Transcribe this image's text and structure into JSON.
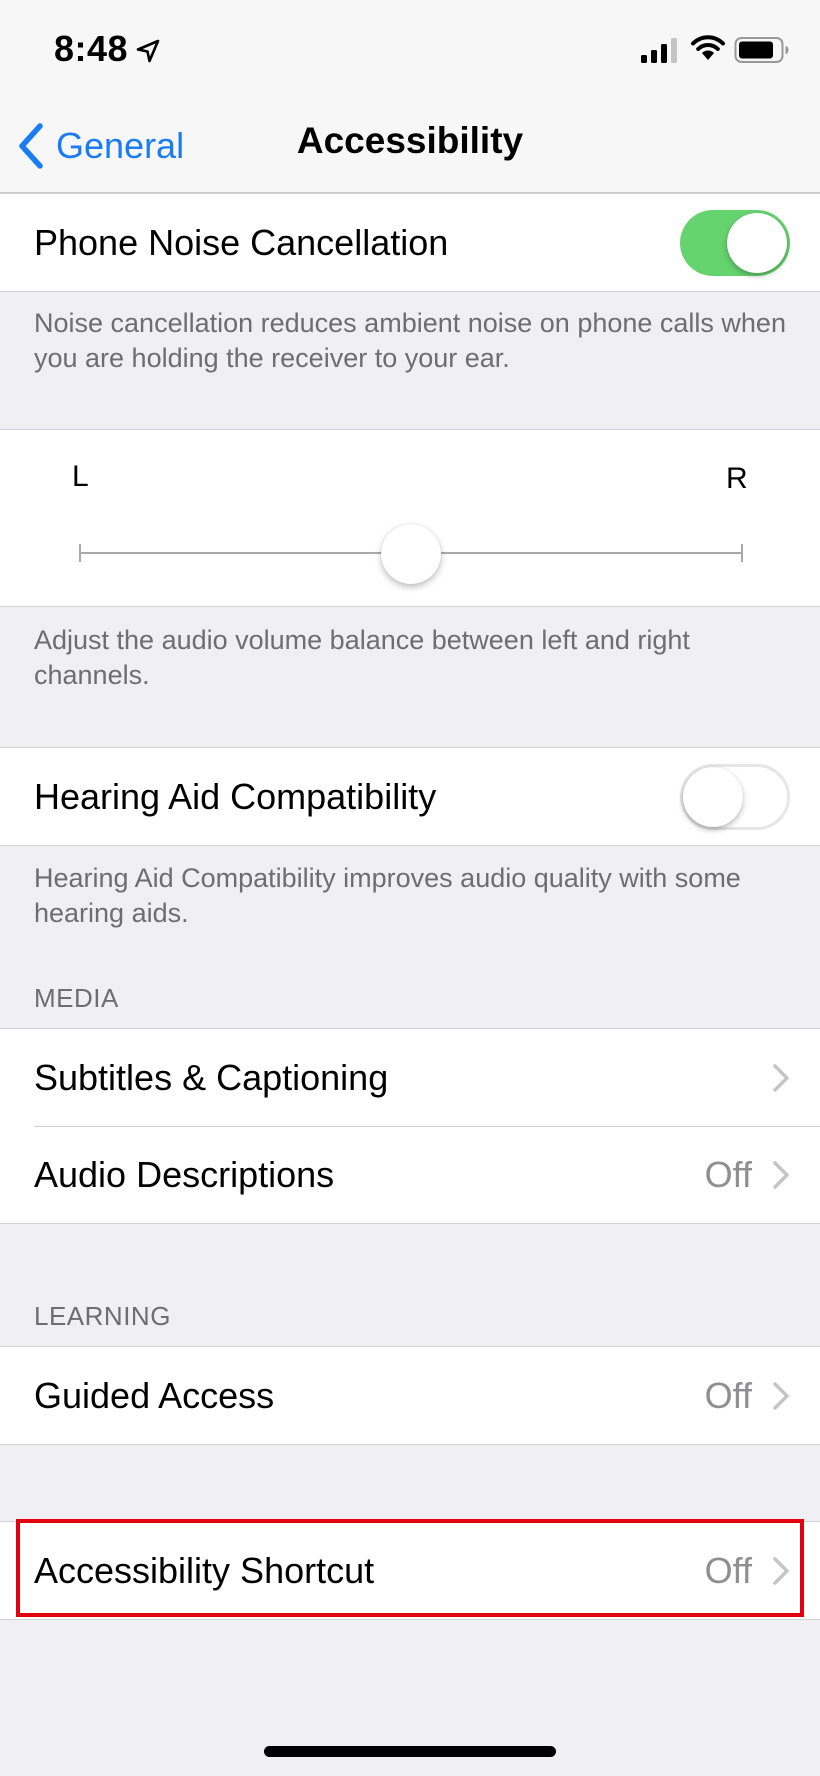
{
  "status_bar": {
    "time": "8:48"
  },
  "nav": {
    "back_label": "General",
    "title": "Accessibility"
  },
  "noise_cancellation": {
    "label": "Phone Noise Cancellation",
    "enabled": true,
    "footnote": "Noise cancellation reduces ambient noise on phone calls when you are holding the receiver to your ear."
  },
  "balance": {
    "left_label": "L",
    "right_label": "R",
    "value": 0.5,
    "footnote": "Adjust the audio volume balance between left and right channels."
  },
  "hearing_aid": {
    "label": "Hearing Aid Compatibility",
    "enabled": false,
    "footnote": "Hearing Aid Compatibility improves audio quality with some hearing aids."
  },
  "media": {
    "header": "MEDIA",
    "items": [
      {
        "label": "Subtitles & Captioning",
        "value": ""
      },
      {
        "label": "Audio Descriptions",
        "value": "Off"
      }
    ]
  },
  "learning": {
    "header": "LEARNING",
    "items": [
      {
        "label": "Guided Access",
        "value": "Off"
      }
    ]
  },
  "shortcut": {
    "items": [
      {
        "label": "Accessibility Shortcut",
        "value": "Off"
      }
    ]
  },
  "colors": {
    "accent": "#1a7cf5",
    "switch_on": "#65d36e",
    "highlight": "#e3000f"
  }
}
